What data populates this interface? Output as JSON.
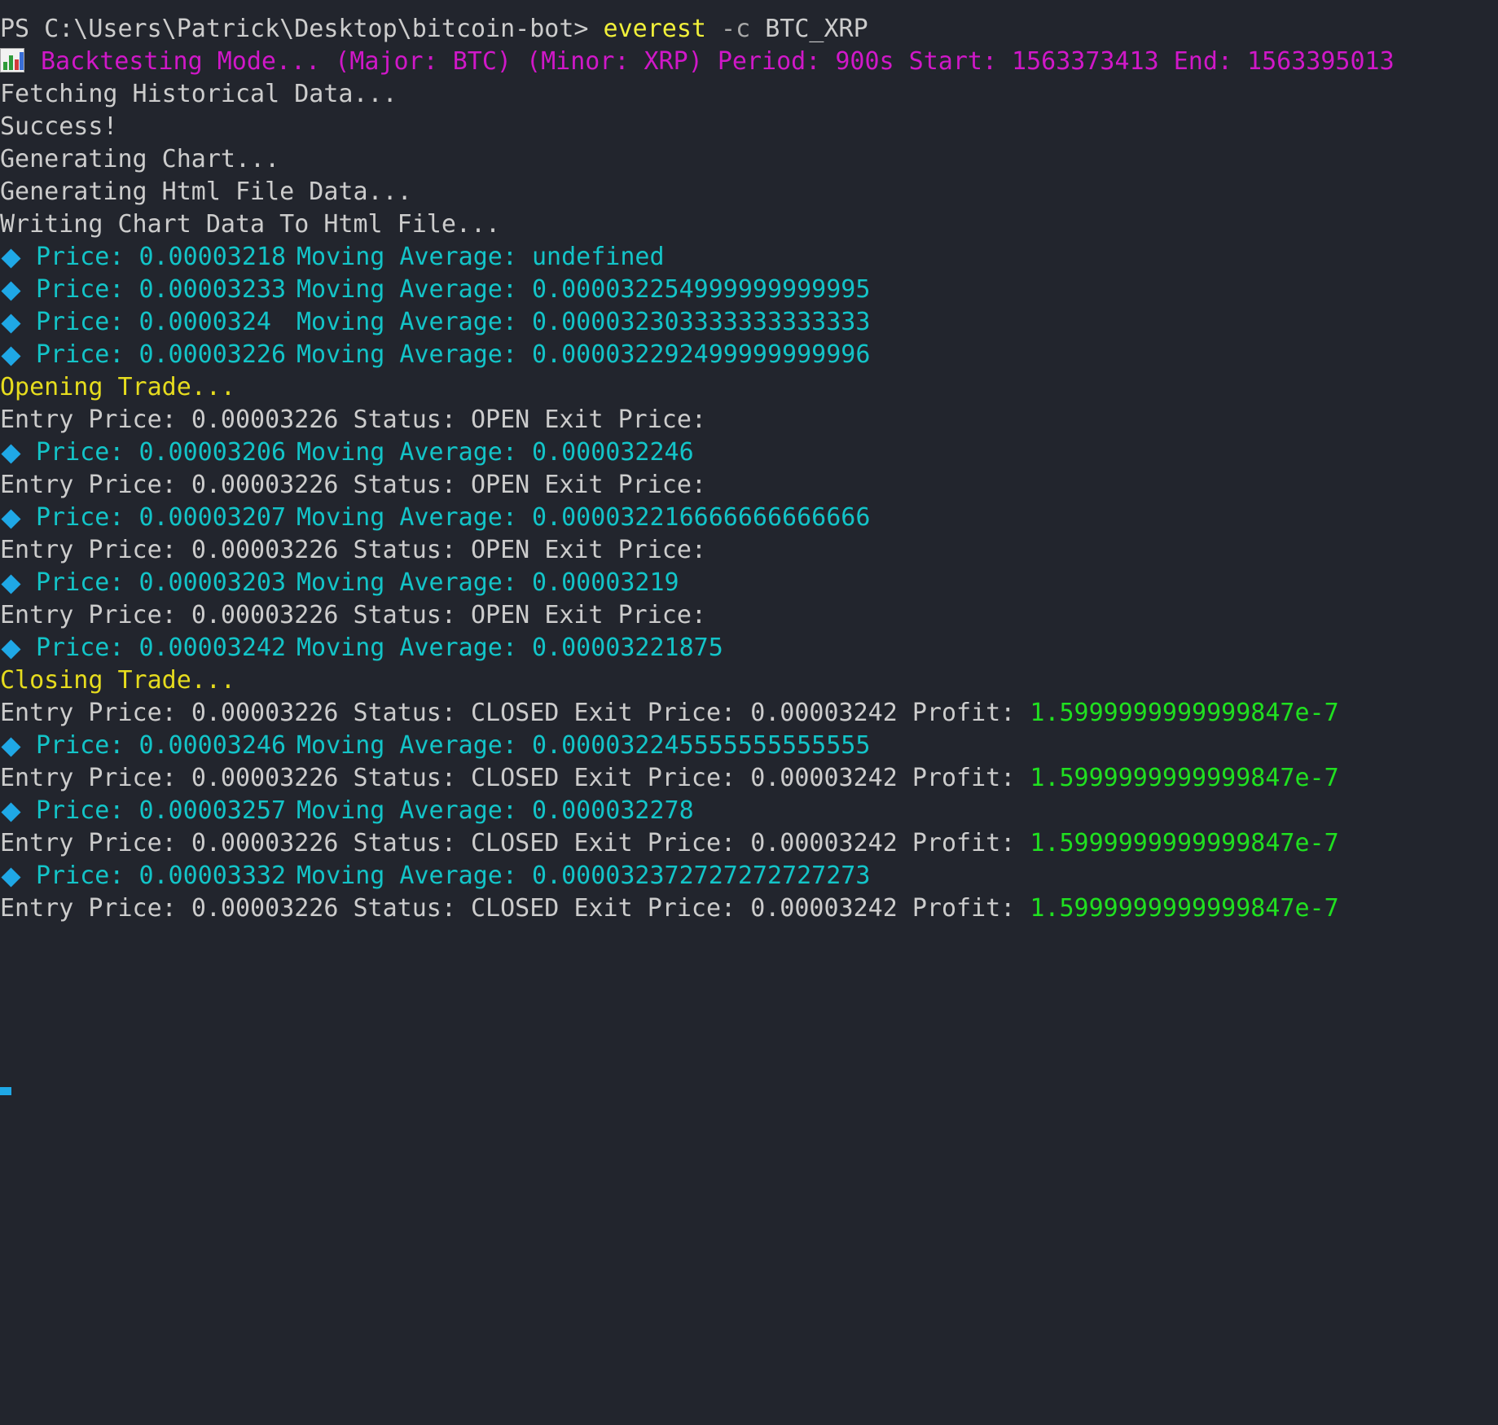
{
  "prompt": {
    "path": "PS C:\\Users\\Patrick\\Desktop\\bitcoin-bot>",
    "command": "everest",
    "flag": "-c",
    "argument": "BTC_XRP"
  },
  "icon_name": "bar-chart-icon",
  "colors": {
    "background": "#22252d",
    "text": "#cccccc",
    "command": "#f1f03a",
    "mode": "#d018c8",
    "price": "#13c4c8",
    "trade_event": "#e6dc1e",
    "profit": "#20e020",
    "diamond": "#1fa8e6"
  },
  "header": "Backtesting Mode... (Major: BTC) (Minor: XRP) Period: 900s Start: 1563373413 End: 1563395013",
  "status_lines": [
    "Fetching Historical Data...",
    "Success!",
    "Generating Chart...",
    "Generating Html File Data...",
    "Writing Chart Data To Html File..."
  ],
  "labels": {
    "price": "Price: ",
    "moving_average": "Moving Average: ",
    "entry_price": "Entry Price: ",
    "status": "Status: ",
    "exit_price": "Exit Price:",
    "profit": "Profit: "
  },
  "ticks": [
    {
      "price": "0.00003218",
      "moving_average": "undefined"
    },
    {
      "price": "0.00003233",
      "moving_average": "0.000032254999999999995"
    },
    {
      "price": "0.0000324",
      "moving_average": "0.000032303333333333333"
    },
    {
      "price": "0.00003226",
      "moving_average": "0.000032292499999999996"
    },
    {
      "price": "0.00003206",
      "moving_average": "0.000032246"
    },
    {
      "price": "0.00003207",
      "moving_average": "0.000032216666666666666"
    },
    {
      "price": "0.00003203",
      "moving_average": "0.00003219"
    },
    {
      "price": "0.00003242",
      "moving_average": "0.00003221875"
    },
    {
      "price": "0.00003246",
      "moving_average": "0.000032245555555555555"
    },
    {
      "price": "0.00003257",
      "moving_average": "0.000032278"
    },
    {
      "price": "0.00003332",
      "moving_average": "0.000032372727272727273"
    }
  ],
  "events": {
    "opening": "Opening Trade...",
    "closing": "Closing Trade..."
  },
  "trade": {
    "entry_price": "0.00003226",
    "status_open": "OPEN",
    "status_closed": "CLOSED",
    "exit_price": "0.00003242",
    "profit": "1.5999999999999847e-7"
  }
}
